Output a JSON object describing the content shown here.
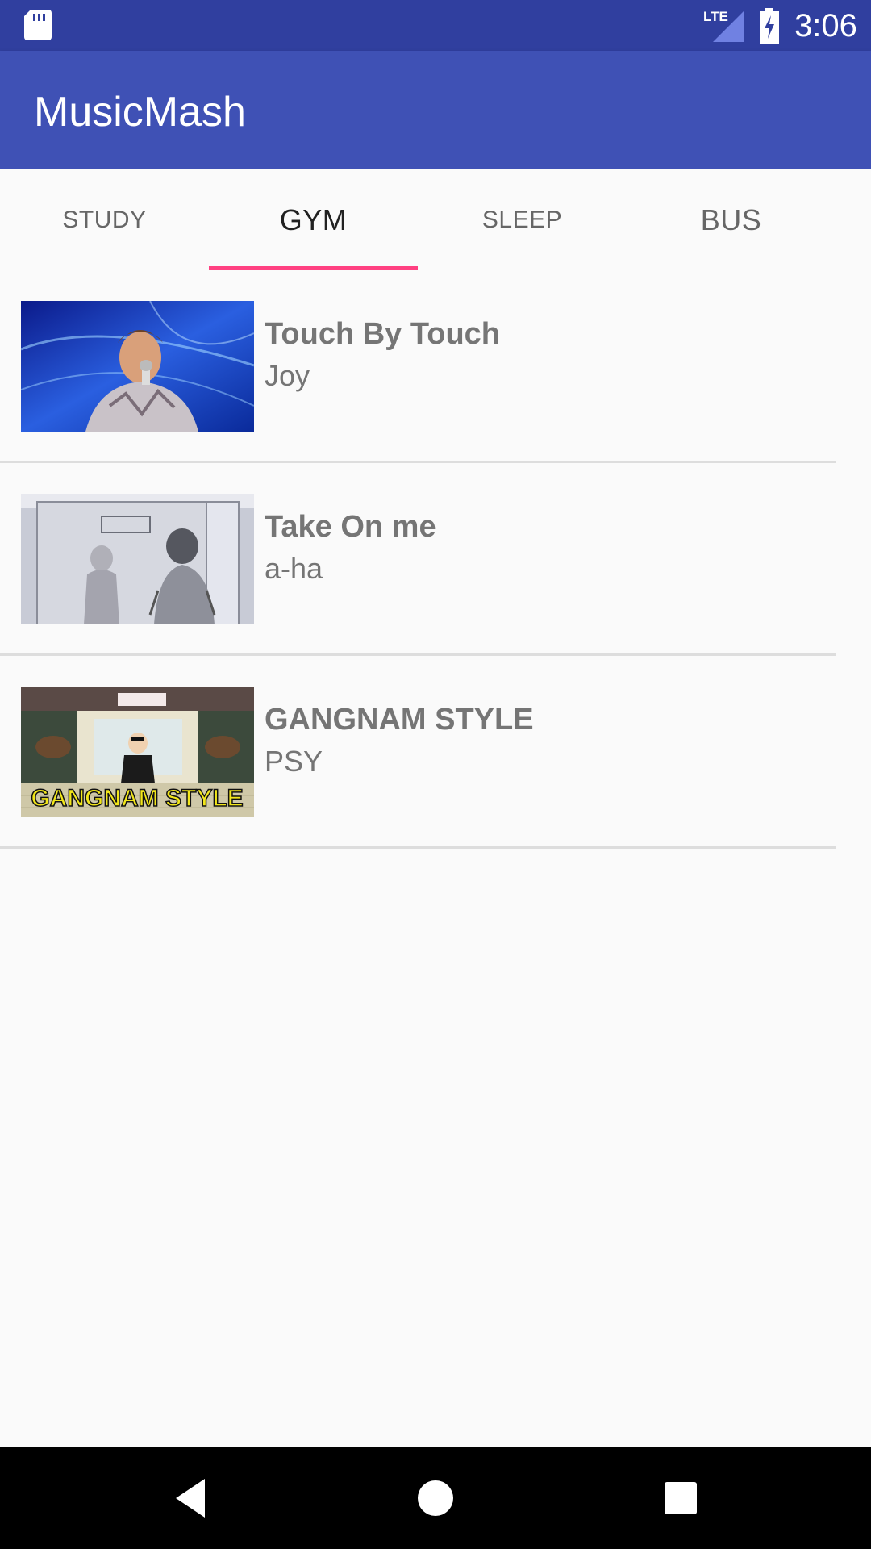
{
  "status_bar": {
    "time": "3:06",
    "network_label": "LTE",
    "icons": [
      "sd-card-icon",
      "lte-signal-icon",
      "battery-charging-icon"
    ]
  },
  "app_bar": {
    "title": "MusicMash"
  },
  "tabs": [
    {
      "label": "STUDY",
      "selected": false
    },
    {
      "label": "GYM",
      "selected": true
    },
    {
      "label": "SLEEP",
      "selected": false
    },
    {
      "label": "BUS",
      "selected": false
    }
  ],
  "songs": [
    {
      "title": "Touch By Touch",
      "artist": "Joy"
    },
    {
      "title": "Take On me",
      "artist": "a-ha"
    },
    {
      "title": "GANGNAM STYLE",
      "artist": "PSY"
    }
  ],
  "thumbnail_text": {
    "gangnam_banner": "GANGNAM STYLE"
  },
  "nav_bar": {
    "icons": [
      "back-icon",
      "home-icon",
      "recents-icon"
    ]
  },
  "colors": {
    "status_bar": "#303f9f",
    "app_bar": "#3f51b5",
    "tab_indicator": "#ff4081",
    "background": "#fafafa"
  }
}
